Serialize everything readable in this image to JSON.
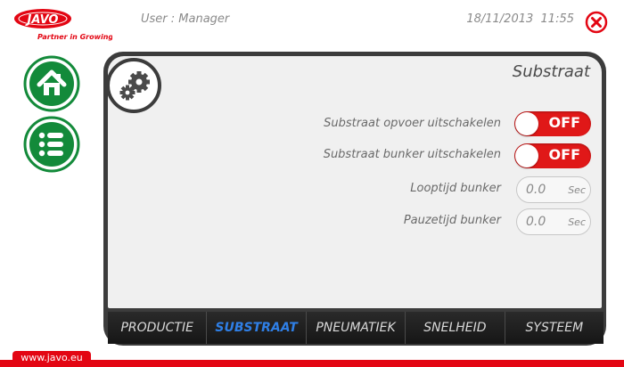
{
  "brand": {
    "name": "JAVO",
    "tagline": "Partner in Growing",
    "primary_color": "#e30613",
    "nav_color": "#138a3a"
  },
  "header": {
    "user_text": "User : Manager",
    "date": "18/11/2013",
    "time": "11:55",
    "close_icon": "close-circle-icon"
  },
  "sidebar": {
    "home_icon": "home-icon",
    "menu_icon": "list-icon"
  },
  "panel": {
    "title": "Substraat",
    "icon": "gears-icon",
    "rows": [
      {
        "label": "Substraat opvoer uitschakelen",
        "type": "toggle",
        "value": "OFF"
      },
      {
        "label": "Substraat bunker uitschakelen",
        "type": "toggle",
        "value": "OFF"
      },
      {
        "label": "Looptijd bunker",
        "type": "number",
        "value": "0.0",
        "unit": "Sec"
      },
      {
        "label": "Pauzetijd bunker",
        "type": "number",
        "value": "0.0",
        "unit": "Sec"
      }
    ]
  },
  "tabs": [
    {
      "label": "PRODUCTIE",
      "active": false
    },
    {
      "label": "SUBSTRAAT",
      "active": true
    },
    {
      "label": "PNEUMATIEK",
      "active": false
    },
    {
      "label": "SNELHEID",
      "active": false
    },
    {
      "label": "SYSTEEM",
      "active": false
    }
  ],
  "footer": {
    "url": "www.javo.eu"
  }
}
